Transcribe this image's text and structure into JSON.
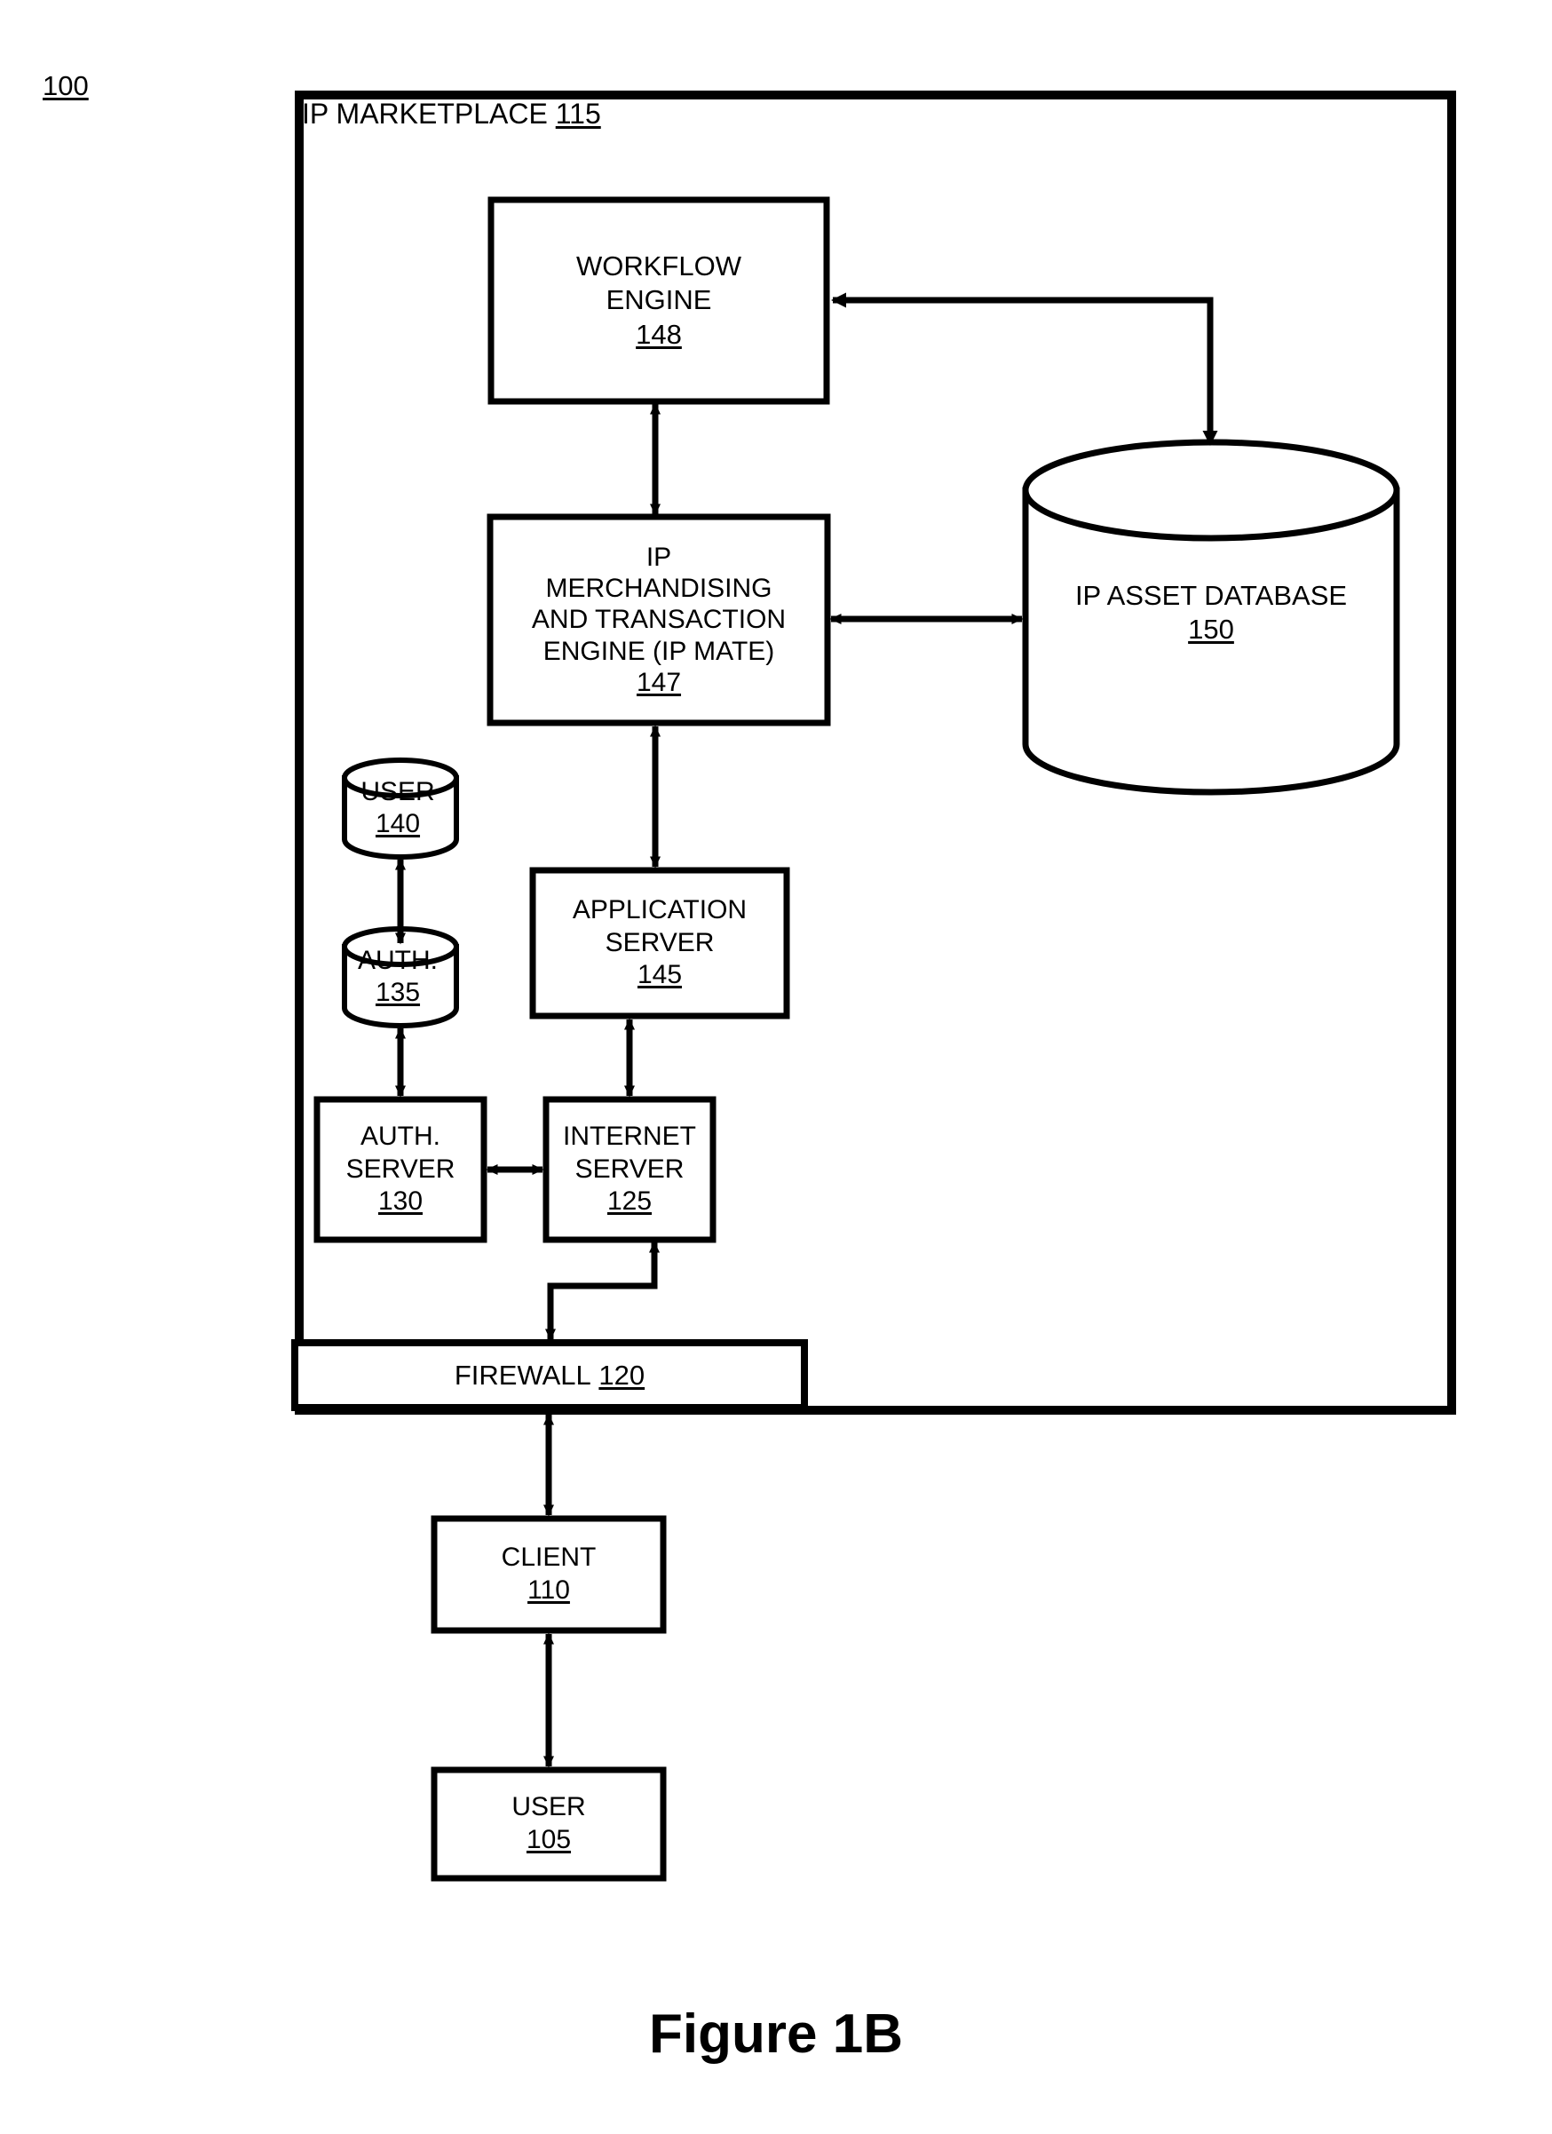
{
  "figure": {
    "caption": "Figure 1B",
    "system_ref": "100"
  },
  "container": {
    "title": "IP MARKETPLACE",
    "ref": "115"
  },
  "nodes": {
    "workflow_engine": {
      "line1": "WORKFLOW",
      "line2": "ENGINE",
      "ref": "148",
      "shape": "rectangle"
    },
    "ip_mate": {
      "line1": "IP",
      "line2": "MERCHANDISING",
      "line3": "AND TRANSACTION",
      "line4": "ENGINE (IP MATE)",
      "ref": "147",
      "shape": "rectangle"
    },
    "ip_asset_database": {
      "line1": "IP ASSET DATABASE",
      "ref": "150",
      "shape": "cylinder"
    },
    "user_db": {
      "line1": "USER",
      "ref": "140",
      "shape": "cylinder"
    },
    "auth_db": {
      "line1": "AUTH.",
      "ref": "135",
      "shape": "cylinder"
    },
    "application_server": {
      "line1": "APPLICATION",
      "line2": "SERVER",
      "ref": "145",
      "shape": "rectangle"
    },
    "auth_server": {
      "line1": "AUTH.",
      "line2": "SERVER",
      "ref": "130",
      "shape": "rectangle"
    },
    "internet_server": {
      "line1": "INTERNET",
      "line2": "SERVER",
      "ref": "125",
      "shape": "rectangle"
    },
    "firewall": {
      "line1": "FIREWALL",
      "ref": "120",
      "shape": "bar"
    },
    "client": {
      "line1": "CLIENT",
      "ref": "110",
      "shape": "rectangle"
    },
    "end_user": {
      "line1": "USER",
      "ref": "105",
      "shape": "rectangle"
    }
  },
  "connectors": [
    {
      "name": "workflow-to-ipmate",
      "from": "workflow_engine",
      "to": "ip_mate",
      "arrow": "double",
      "style": "straight"
    },
    {
      "name": "workflow-to-ipdb",
      "from": "workflow_engine",
      "to": "ip_asset_database",
      "arrow": "single",
      "style": "elbow"
    },
    {
      "name": "ipmate-to-ipdb",
      "from": "ip_mate",
      "to": "ip_asset_database",
      "arrow": "double",
      "style": "straight"
    },
    {
      "name": "ipmate-to-appserver",
      "from": "ip_mate",
      "to": "application_server",
      "arrow": "double",
      "style": "straight"
    },
    {
      "name": "userdb-to-authdb",
      "from": "user_db",
      "to": "auth_db",
      "arrow": "double",
      "style": "straight"
    },
    {
      "name": "authdb-to-authserver",
      "from": "auth_db",
      "to": "auth_server",
      "arrow": "double",
      "style": "straight"
    },
    {
      "name": "appserver-to-internetserver",
      "from": "application_server",
      "to": "internet_server",
      "arrow": "double",
      "style": "straight"
    },
    {
      "name": "authserver-to-internetserver",
      "from": "auth_server",
      "to": "internet_server",
      "arrow": "double",
      "style": "straight"
    },
    {
      "name": "internetserver-to-firewall",
      "from": "internet_server",
      "to": "firewall",
      "arrow": "double",
      "style": "elbow"
    },
    {
      "name": "firewall-to-client",
      "from": "firewall",
      "to": "client",
      "arrow": "double",
      "style": "straight"
    },
    {
      "name": "client-to-user",
      "from": "client",
      "to": "end_user",
      "arrow": "double",
      "style": "straight"
    }
  ],
  "colors": {
    "stroke": "#000000",
    "background": "#ffffff"
  }
}
